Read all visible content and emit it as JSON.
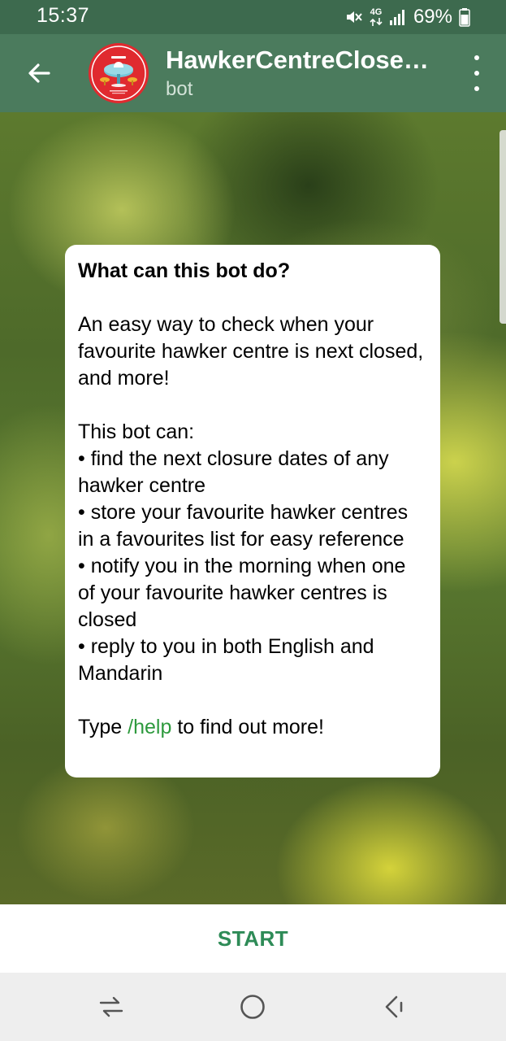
{
  "status_bar": {
    "time": "15:37",
    "network": "4G",
    "battery_percent": "69%",
    "icons": [
      "mute-vibrate-icon",
      "4g-data-icon",
      "signal-icon",
      "battery-icon"
    ]
  },
  "header": {
    "title": "HawkerCentreClosedB…",
    "subtitle": "bot",
    "avatar_color": "#e02a2f",
    "header_color": "#4b7b5d",
    "status_bar_color": "#3d6a4e"
  },
  "bot_card": {
    "title": "What can this bot do?",
    "intro": "An easy way to check when your favourite hawker centre is next closed, and more!",
    "list_intro": "This bot can:",
    "features": [
      "• find the next closure dates of any hawker centre",
      "• store your favourite hawker centres in a favourites list for easy reference",
      "• notify you in the morning when one of your favourite hawker centres is closed",
      "• reply to you in both English and Mandarin"
    ],
    "help_prefix": "Type ",
    "help_command": "/help",
    "help_suffix": " to find out more!",
    "link_color": "#2e9a3e"
  },
  "start_button": {
    "label": "START",
    "color": "#2e8b57"
  },
  "nav_bar": {
    "buttons": [
      "recent-apps-icon",
      "home-icon",
      "back-icon"
    ]
  }
}
